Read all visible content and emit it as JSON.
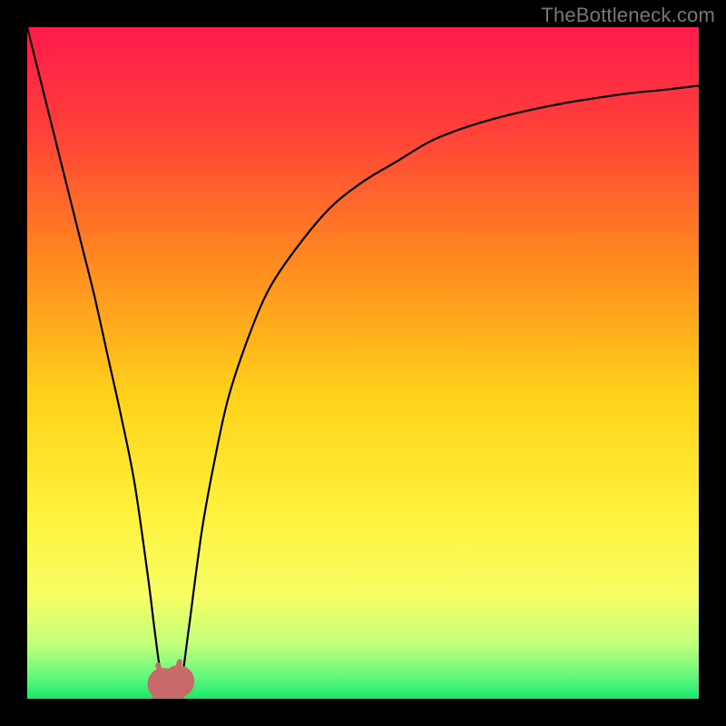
{
  "watermark": "TheBottleneck.com",
  "chart_data": {
    "type": "line",
    "title": "",
    "xlabel": "",
    "ylabel": "",
    "xlim": [
      0,
      100
    ],
    "ylim": [
      0,
      100
    ],
    "grid": false,
    "legend": false,
    "gradient_stops": [
      {
        "offset": 0,
        "color": "#ff1a4b"
      },
      {
        "offset": 0.15,
        "color": "#ff3f3a"
      },
      {
        "offset": 0.35,
        "color": "#ff8a1f"
      },
      {
        "offset": 0.55,
        "color": "#ffd21a"
      },
      {
        "offset": 0.72,
        "color": "#fff13a"
      },
      {
        "offset": 0.85,
        "color": "#f6ff66"
      },
      {
        "offset": 0.92,
        "color": "#bfff7a"
      },
      {
        "offset": 0.97,
        "color": "#5cf77d"
      },
      {
        "offset": 1.0,
        "color": "#17e86a"
      }
    ],
    "series": [
      {
        "name": "bottleneck-curve",
        "x": [
          0,
          2,
          4,
          6,
          8,
          10,
          12,
          14,
          16,
          18,
          19,
          20,
          21,
          22,
          23,
          24,
          26,
          28,
          30,
          33,
          36,
          40,
          45,
          50,
          55,
          60,
          65,
          70,
          75,
          80,
          85,
          90,
          95,
          100
        ],
        "y": [
          100,
          92,
          84,
          76,
          68,
          60,
          51,
          42,
          32,
          18,
          10,
          3,
          1,
          1,
          3,
          10,
          25,
          36,
          45,
          54,
          61,
          67,
          73,
          77,
          80,
          83,
          85,
          86.5,
          87.7,
          88.7,
          89.5,
          90.2,
          90.7,
          91.3
        ]
      }
    ],
    "markers": [
      {
        "name": "min-marker-left",
        "x": 20.3,
        "y": 2.2,
        "r": 2.4,
        "color": "#c86a6a"
      },
      {
        "name": "min-marker-bottom",
        "x": 21.0,
        "y": 0.8,
        "r": 2.4,
        "color": "#c86a6a"
      },
      {
        "name": "min-marker-right",
        "x": 22.5,
        "y": 2.6,
        "r": 2.4,
        "color": "#c86a6a"
      }
    ],
    "min_u_stroke": {
      "color": "#c86a6a",
      "width": 6,
      "points_x": [
        19.5,
        20.2,
        20.7,
        21.0,
        21.3,
        21.8,
        22.7
      ],
      "points_y": [
        5.0,
        2.0,
        0.9,
        0.8,
        0.9,
        2.0,
        5.5
      ]
    }
  }
}
